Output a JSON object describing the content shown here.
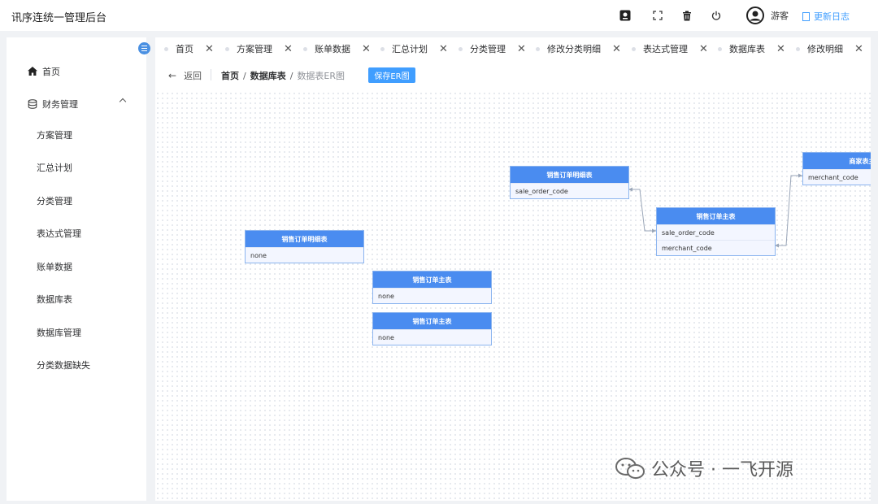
{
  "app": {
    "title": "讯序连统一管理后台"
  },
  "topbar": {
    "icons": [
      "badge-icon",
      "fullscreen-icon",
      "trash-icon",
      "power-icon"
    ],
    "user_name": "游客",
    "changelog_label": "更新日志"
  },
  "sidebar": {
    "home_label": "首页",
    "group_label": "财务管理",
    "items": [
      {
        "label": "方案管理"
      },
      {
        "label": "汇总计划"
      },
      {
        "label": "分类管理"
      },
      {
        "label": "表达式管理"
      },
      {
        "label": "账单数据"
      },
      {
        "label": "数据库表"
      },
      {
        "label": "数据库管理"
      },
      {
        "label": "分类数据缺失"
      }
    ]
  },
  "tabs": [
    {
      "label": "首页"
    },
    {
      "label": "方案管理"
    },
    {
      "label": "账单数据"
    },
    {
      "label": "汇总计划"
    },
    {
      "label": "分类管理"
    },
    {
      "label": "修改分类明细"
    },
    {
      "label": "表达式管理"
    },
    {
      "label": "数据库表"
    },
    {
      "label": "修改明细"
    }
  ],
  "header": {
    "back_label": "返回",
    "breadcrumb": [
      "首页",
      "数据库表",
      "数据表ER图"
    ],
    "save_label": "保存ER图"
  },
  "er_tables": [
    {
      "title": "销售订单明细表",
      "fields": [
        "none"
      ]
    },
    {
      "title": "销售订单主表",
      "fields": [
        "none"
      ]
    },
    {
      "title": "销售订单主表",
      "fields": [
        "none"
      ]
    },
    {
      "title": "销售订单明细表",
      "fields": [
        "sale_order_code"
      ]
    },
    {
      "title": "销售订单主表",
      "fields": [
        "sale_order_code",
        "merchant_code"
      ]
    },
    {
      "title": "商家表主",
      "fields": [
        "merchant_code"
      ]
    }
  ],
  "watermark": {
    "text": "公众号 · 一飞开源"
  },
  "colors": {
    "accent": "#409eff",
    "er_header": "#4a8cf0",
    "er_row": "#f3f6ff"
  }
}
